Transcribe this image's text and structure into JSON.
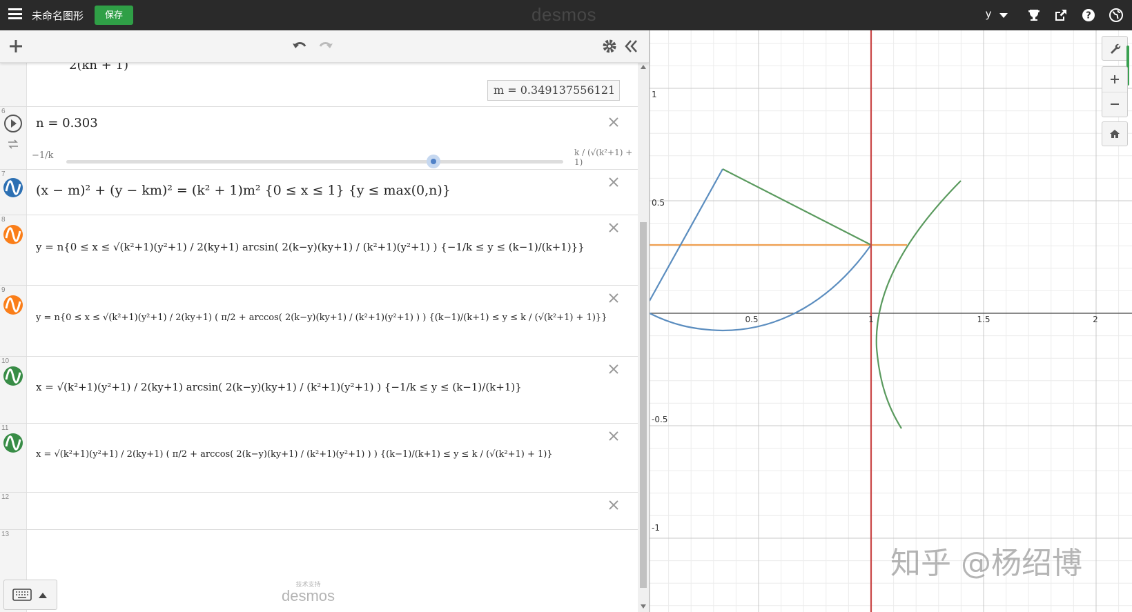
{
  "topbar": {
    "title": "未命名图形",
    "save_label": "保存",
    "logo": "desmos",
    "user": "y"
  },
  "expressions": {
    "row5_fragment": "2(kn + 1)",
    "row5_value": "m  =  0.349137556121",
    "row6": {
      "number": "6",
      "formula": "n = 0.303",
      "slider_min": "−1/k",
      "slider_max": "k / (√(k²+1) + 1)",
      "slider_value_fraction": 0.717
    },
    "row7": {
      "number": "7",
      "color": "#2d70b3",
      "formula": "(x − m)² + (y − km)² = (k² + 1)m² {0 ≤ x ≤ 1} {y ≤ max(0,n)}"
    },
    "row8": {
      "number": "8",
      "color": "#fa7e19",
      "formula": "y = n{0 ≤ x ≤ √(k²+1)(y²+1) / 2(ky+1) arcsin( 2(k−y)(ky+1) / (k²+1)(y²+1) ) {−1/k ≤ y ≤ (k−1)/(k+1)}}"
    },
    "row9": {
      "number": "9",
      "color": "#fa7e19",
      "formula": "y = n{0 ≤ x ≤ √(k²+1)(y²+1) / 2(ky+1) ( π/2 + arccos( 2(k−y)(ky+1) / (k²+1)(y²+1) ) ) {(k−1)/(k+1) ≤ y ≤ k / (√(k²+1) + 1)}}"
    },
    "row10": {
      "number": "10",
      "color": "#388c46",
      "formula": "x = √(k²+1)(y²+1) / 2(ky+1) arcsin( 2(k−y)(ky+1) / (k²+1)(y²+1) ) {−1/k ≤ y ≤ (k−1)/(k+1)}"
    },
    "row11": {
      "number": "11",
      "color": "#388c46",
      "formula": "x = √(k²+1)(y²+1) / 2(ky+1) ( π/2 + arccos( 2(k−y)(ky+1) / (k²+1)(y²+1) ) ) {(k−1)/(k+1) ≤ y ≤ k / (√(k²+1) + 1)}"
    },
    "row12": {
      "number": "12"
    },
    "row13": {
      "number": "13"
    }
  },
  "footer": {
    "powered_small": "技术支持",
    "powered_big": "desmos"
  },
  "graph": {
    "x_ticks": [
      "0.5",
      "1",
      "1.5",
      "2"
    ],
    "y_ticks": [
      "1",
      "0.5",
      "-0.5",
      "-1"
    ],
    "colors": {
      "blue": "#5b8dbf",
      "green": "#5a9a5e",
      "orange": "#f0a050",
      "red": "#c94646"
    },
    "watermark": "知乎 @杨绍博"
  }
}
